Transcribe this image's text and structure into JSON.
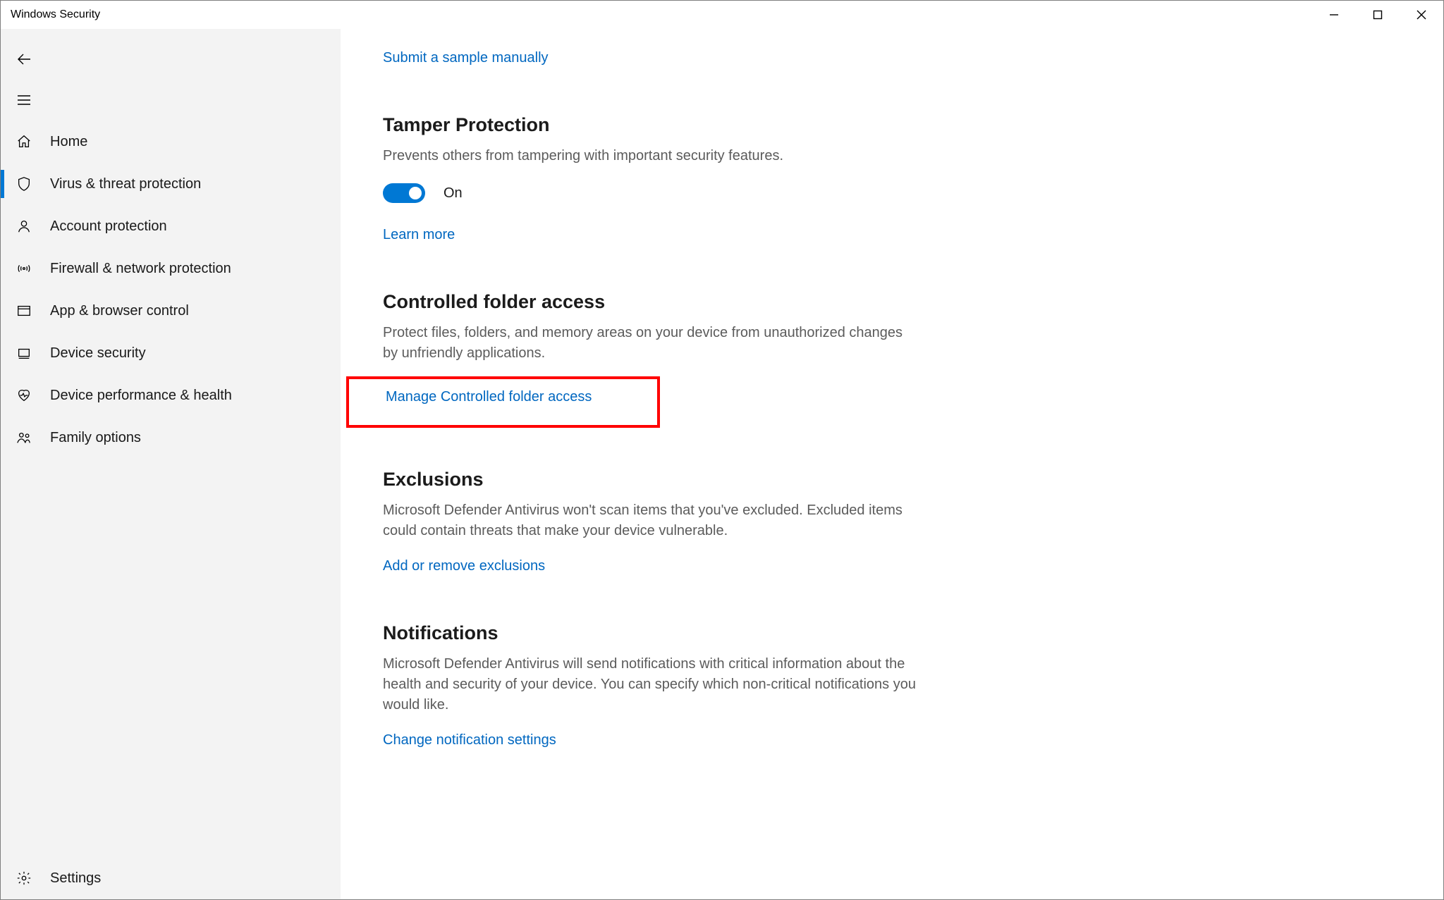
{
  "titlebar": {
    "title": "Windows Security"
  },
  "sidebar": {
    "items": [
      {
        "id": "home",
        "label": "Home"
      },
      {
        "id": "virus",
        "label": "Virus & threat protection",
        "selected": true
      },
      {
        "id": "account",
        "label": "Account protection"
      },
      {
        "id": "firewall",
        "label": "Firewall & network protection"
      },
      {
        "id": "appbrowser",
        "label": "App & browser control"
      },
      {
        "id": "device",
        "label": "Device security"
      },
      {
        "id": "perf",
        "label": "Device performance & health"
      },
      {
        "id": "family",
        "label": "Family options"
      }
    ],
    "settings_label": "Settings"
  },
  "main": {
    "submit_link": "Submit a sample manually",
    "tamper": {
      "heading": "Tamper Protection",
      "desc": "Prevents others from tampering with important security features.",
      "toggle_state": "On",
      "learn_more": "Learn more"
    },
    "cfa": {
      "heading": "Controlled folder access",
      "desc": "Protect files, folders, and memory areas on your device from unauthorized changes by unfriendly applications.",
      "manage_link": "Manage Controlled folder access"
    },
    "exclusions": {
      "heading": "Exclusions",
      "desc": "Microsoft Defender Antivirus won't scan items that you've excluded. Excluded items could contain threats that make your device vulnerable.",
      "link": "Add or remove exclusions"
    },
    "notifications": {
      "heading": "Notifications",
      "desc": "Microsoft Defender Antivirus will send notifications with critical information about the health and security of your device. You can specify which non-critical notifications you would like.",
      "link": "Change notification settings"
    }
  }
}
